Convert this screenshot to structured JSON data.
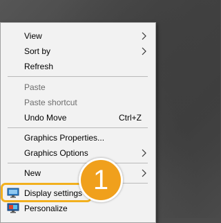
{
  "context_menu": {
    "items": [
      {
        "label": "View",
        "submenu": true
      },
      {
        "label": "Sort by",
        "submenu": true
      },
      {
        "label": "Refresh"
      },
      {
        "label": "Paste",
        "disabled": true
      },
      {
        "label": "Paste shortcut",
        "disabled": true
      },
      {
        "label": "Undo Move",
        "shortcut": "Ctrl+Z"
      },
      {
        "label": "Graphics Properties..."
      },
      {
        "label": "Graphics Options",
        "submenu": true
      },
      {
        "label": "New",
        "submenu": true
      },
      {
        "label": "Display settings",
        "icon": "display-settings-icon"
      },
      {
        "label": "Personalize",
        "icon": "personalize-icon"
      }
    ]
  },
  "callout": {
    "number": "1",
    "color": "#f0a01c"
  },
  "colors": {
    "highlight_border": "#f2b01e",
    "menu_background": "#f2f2f2",
    "disabled_text": "#6d6d6d"
  }
}
